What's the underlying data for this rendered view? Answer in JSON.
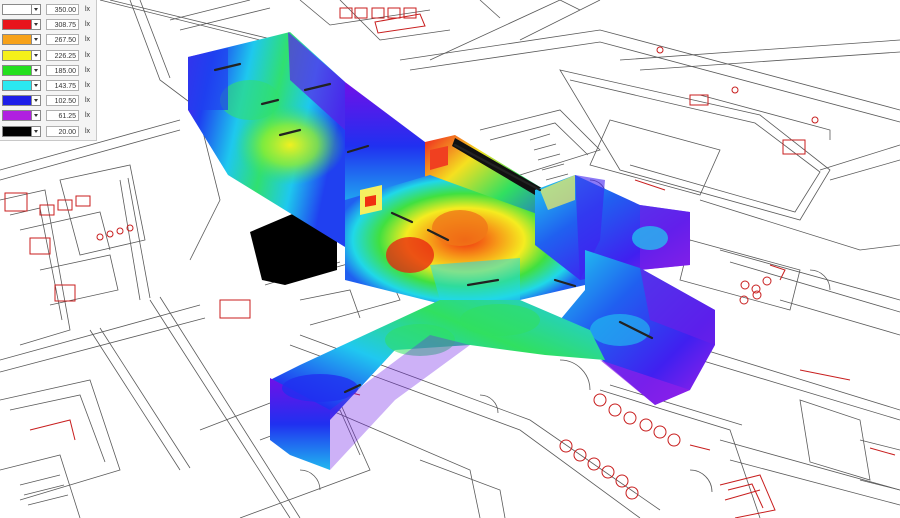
{
  "legend": {
    "unit": "lx",
    "items": [
      {
        "value": "350.00",
        "color": "#ffffff"
      },
      {
        "value": "308.75",
        "color": "#e8141c"
      },
      {
        "value": "267.50",
        "color": "#f7a21a"
      },
      {
        "value": "226.25",
        "color": "#f5f01a"
      },
      {
        "value": "185.00",
        "color": "#23e01e"
      },
      {
        "value": "143.75",
        "color": "#2be8f0"
      },
      {
        "value": "102.50",
        "color": "#1e1ee8"
      },
      {
        "value": "61.25",
        "color": "#b020e0"
      },
      {
        "value": "20.00",
        "color": "#000000"
      }
    ]
  },
  "scene": {
    "icon": "lighting-falsecolor-3d-view",
    "floorplan_line_color": "#555555",
    "furniture_color": "#c81e1e"
  }
}
